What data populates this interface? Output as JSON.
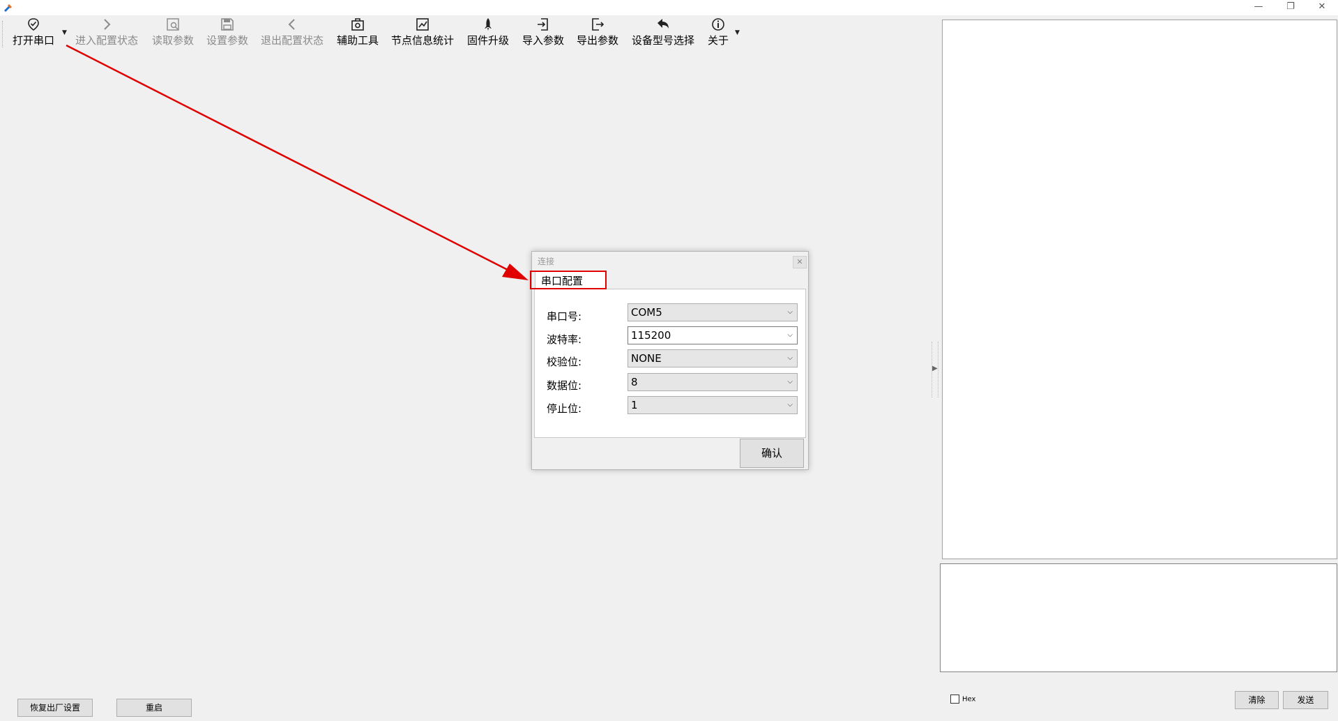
{
  "window": {
    "minimize": "—",
    "restore": "❐",
    "close": "✕"
  },
  "toolbar": {
    "items": [
      {
        "label": "打开串口",
        "icon": "check-badge-icon",
        "enabled": true
      },
      {
        "label": "进入配置状态",
        "icon": "chevron-right-icon",
        "enabled": false
      },
      {
        "label": "读取参数",
        "icon": "read-params-icon",
        "enabled": false
      },
      {
        "label": "设置参数",
        "icon": "save-icon",
        "enabled": false
      },
      {
        "label": "退出配置状态",
        "icon": "chevron-left-icon",
        "enabled": false
      },
      {
        "label": "辅助工具",
        "icon": "toolbox-icon",
        "enabled": true
      },
      {
        "label": "节点信息统计",
        "icon": "statistics-icon",
        "enabled": true
      },
      {
        "label": "固件升级",
        "icon": "rocket-icon",
        "enabled": true
      },
      {
        "label": "导入参数",
        "icon": "import-icon",
        "enabled": true
      },
      {
        "label": "导出参数",
        "icon": "export-icon",
        "enabled": true
      },
      {
        "label": "设备型号选择",
        "icon": "undo-arrow-icon",
        "enabled": true
      },
      {
        "label": "关于",
        "icon": "info-icon",
        "enabled": true
      }
    ]
  },
  "bottom_left": {
    "factory_reset": "恢复出厂设置",
    "restart": "重启"
  },
  "right": {
    "hex_label": "Hex",
    "clear": "清除",
    "send": "发送"
  },
  "dialog": {
    "title": "连接",
    "tab": "串口配置",
    "fields": [
      {
        "label": "串口号:",
        "value": "COM5"
      },
      {
        "label": "波特率:",
        "value": "115200"
      },
      {
        "label": "校验位:",
        "value": "NONE"
      },
      {
        "label": "数据位:",
        "value": "8"
      },
      {
        "label": "停止位:",
        "value": "1"
      }
    ],
    "confirm": "确认"
  },
  "annotation": {
    "color": "#e00000"
  }
}
